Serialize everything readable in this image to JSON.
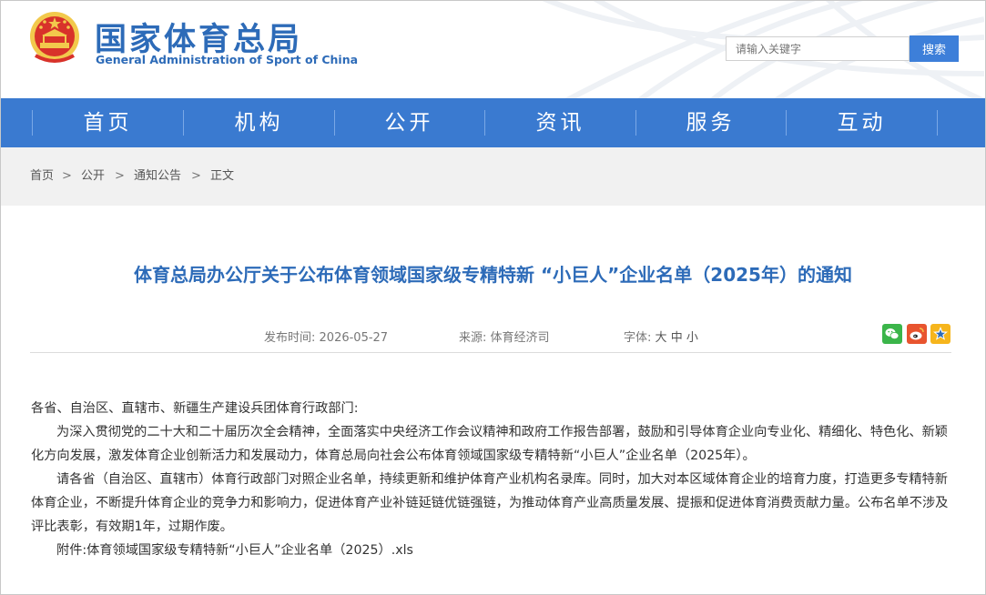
{
  "header": {
    "title": "国家体育总局",
    "subtitle": "General Administration of Sport of China",
    "search_placeholder": "请输入关键字",
    "search_button": "搜索"
  },
  "nav": {
    "items": [
      {
        "label": "首页"
      },
      {
        "label": "机构"
      },
      {
        "label": "公开"
      },
      {
        "label": "资讯"
      },
      {
        "label": "服务"
      },
      {
        "label": "互动"
      }
    ]
  },
  "breadcrumb": {
    "items": [
      "首页",
      "公开",
      "通知公告",
      "正文"
    ],
    "separator": ">"
  },
  "article": {
    "title": "体育总局办公厅关于公布体育领域国家级专精特新 “小巨人”企业名单（2025年）的通知",
    "publish_label": "发布时间:",
    "publish_date": "2026-05-27",
    "source_label": "来源:",
    "source": "体育经济司",
    "font_label": "字体:",
    "font_large": "大",
    "font_medium": "中",
    "font_small": "小",
    "share_icons": [
      "wechat-icon",
      "weibo-icon",
      "favorite-icon"
    ],
    "salutation": "各省、自治区、直辖市、新疆生产建设兵团体育行政部门:",
    "paragraph1": "为深入贯彻党的二十大和二十届历次全会精神，全面落实中央经济工作会议精神和政府工作报告部署，鼓励和引导体育企业向专业化、精细化、特色化、新颖化方向发展，激发体育企业创新活力和发展动力，体育总局向社会公布体育领域国家级专精特新“小巨人”企业名单（2025年）。",
    "paragraph2": "请各省（自治区、直辖市）体育行政部门对照企业名单，持续更新和维护体育产业机构名录库。同时，加大对本区域体育企业的培育力度，打造更多专精特新体育企业，不断提升体育企业的竞争力和影响力，促进体育产业补链延链优链强链，为推动体育产业高质量发展、提振和促进体育消费贡献力量。公布名单不涉及评比表彰，有效期1年，过期作废。",
    "attachment_label": "附件:",
    "attachment_link": "体育领域国家级专精特新“小巨人”企业名单（2025）.xls"
  },
  "colors": {
    "brand_blue": "#2d6bb8",
    "nav_blue": "#3a7ad0",
    "button_blue": "#3d7fd9"
  }
}
